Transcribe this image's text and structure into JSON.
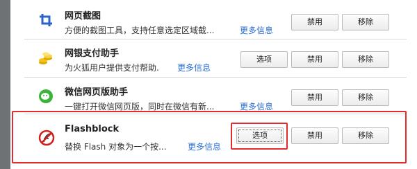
{
  "addons": [
    {
      "name": "网页截图",
      "description": "方便的截图工具，支持任意选定区域截...",
      "more_label": "更多信息",
      "buttons": [
        "禁用",
        "移除"
      ],
      "icon": "crop-icon"
    },
    {
      "name": "网银支付助手",
      "description": "为火狐用户提供支付帮助.",
      "more_label": "更多信息",
      "buttons": [
        "选项",
        "禁用",
        "移除"
      ],
      "icon": "coins-icon"
    },
    {
      "name": "微信网页版助手",
      "description": "一键打开微信网页版，同时在微信有新...",
      "more_label": "更多信息",
      "buttons": [
        "禁用",
        "移除"
      ],
      "icon": "wechat-icon"
    },
    {
      "name": "Flashblock",
      "description": "替换 Flash 对象为一个按...",
      "more_label": "更多信息",
      "buttons": [
        "选项",
        "禁用",
        "移除"
      ],
      "icon": "flash-blocked-icon"
    }
  ],
  "colors": {
    "highlight": "#e32b2b",
    "link": "#2a6fd6",
    "window_frame": "#6f7275"
  }
}
